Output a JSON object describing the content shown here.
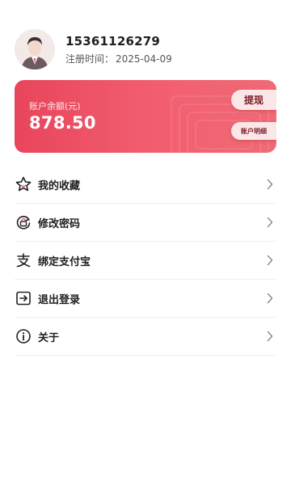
{
  "profile": {
    "phone": "15361126279",
    "register_label": "注册时间：",
    "register_date": "2025-04-09"
  },
  "account": {
    "balance_label": "账户余额(元)",
    "balance": "878.50",
    "withdraw_label": "提现",
    "detail_label": "账户明细"
  },
  "menu": {
    "items": [
      {
        "label": "我的收藏",
        "icon": "star-icon"
      },
      {
        "label": "修改密码",
        "icon": "password-lock-icon"
      },
      {
        "label": "绑定支付宝",
        "icon": "alipay-icon"
      },
      {
        "label": "退出登录",
        "icon": "logout-icon"
      },
      {
        "label": "关于",
        "icon": "info-icon"
      }
    ]
  },
  "colors": {
    "card_start": "#e8455b",
    "card_end": "#ef6a76",
    "pill_bg": "#fbe7e8",
    "pill_text": "#7a1c25",
    "icon_accent": "#e8455b"
  }
}
